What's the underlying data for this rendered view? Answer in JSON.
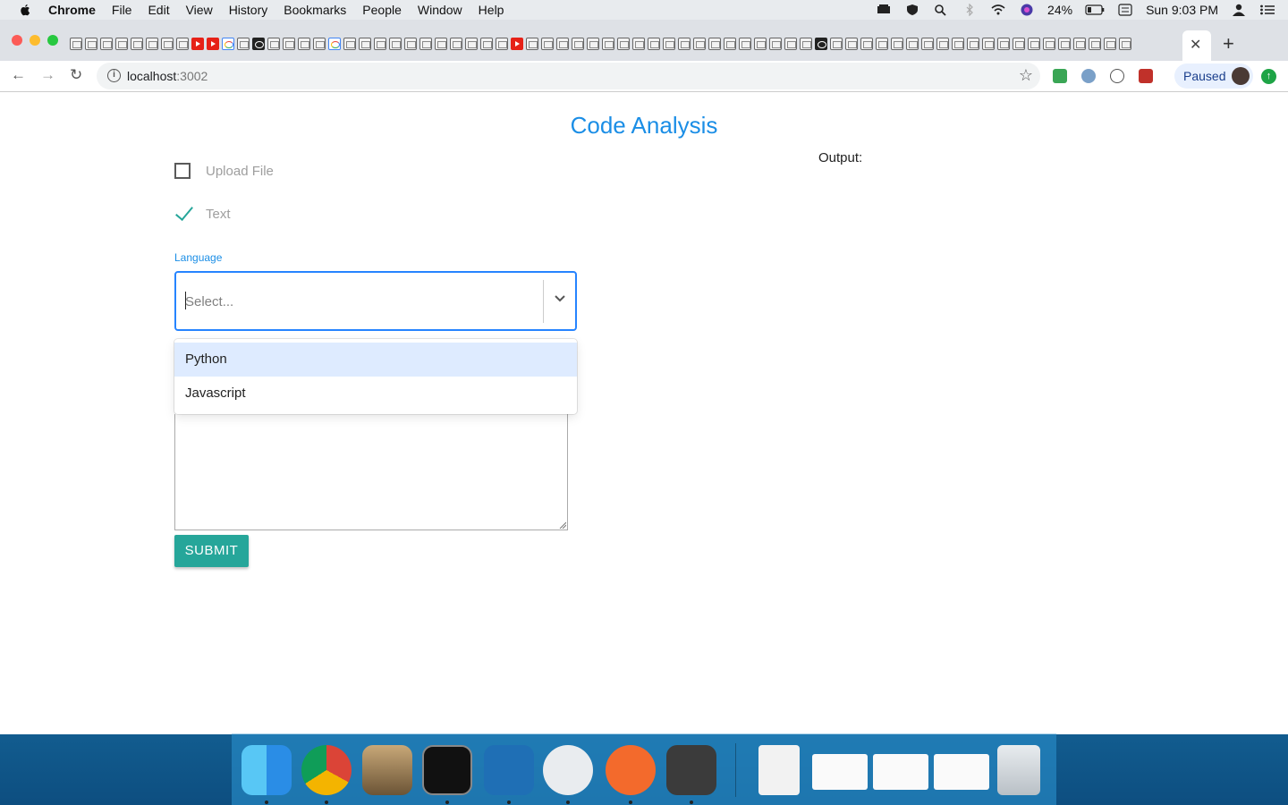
{
  "menubar": {
    "app": "Chrome",
    "items": [
      "File",
      "Edit",
      "View",
      "History",
      "Bookmarks",
      "People",
      "Window",
      "Help"
    ],
    "battery": "24%",
    "clock": "Sun 9:03 PM"
  },
  "browser": {
    "url_host": "localhost",
    "url_port": ":3002",
    "profile_status": "Paused"
  },
  "page": {
    "title": "Code Analysis",
    "output_label": "Output:",
    "upload_option": "Upload File",
    "text_option": "Text",
    "language_label": "Language",
    "select_placeholder": "Select...",
    "language_options": [
      "Python",
      "Javascript"
    ],
    "submit_label": "SUBMIT"
  },
  "colors": {
    "accent_blue": "#1b8ee6",
    "teal": "#26a69a",
    "focus_border": "#2684ff",
    "option_focus": "#deebff"
  }
}
